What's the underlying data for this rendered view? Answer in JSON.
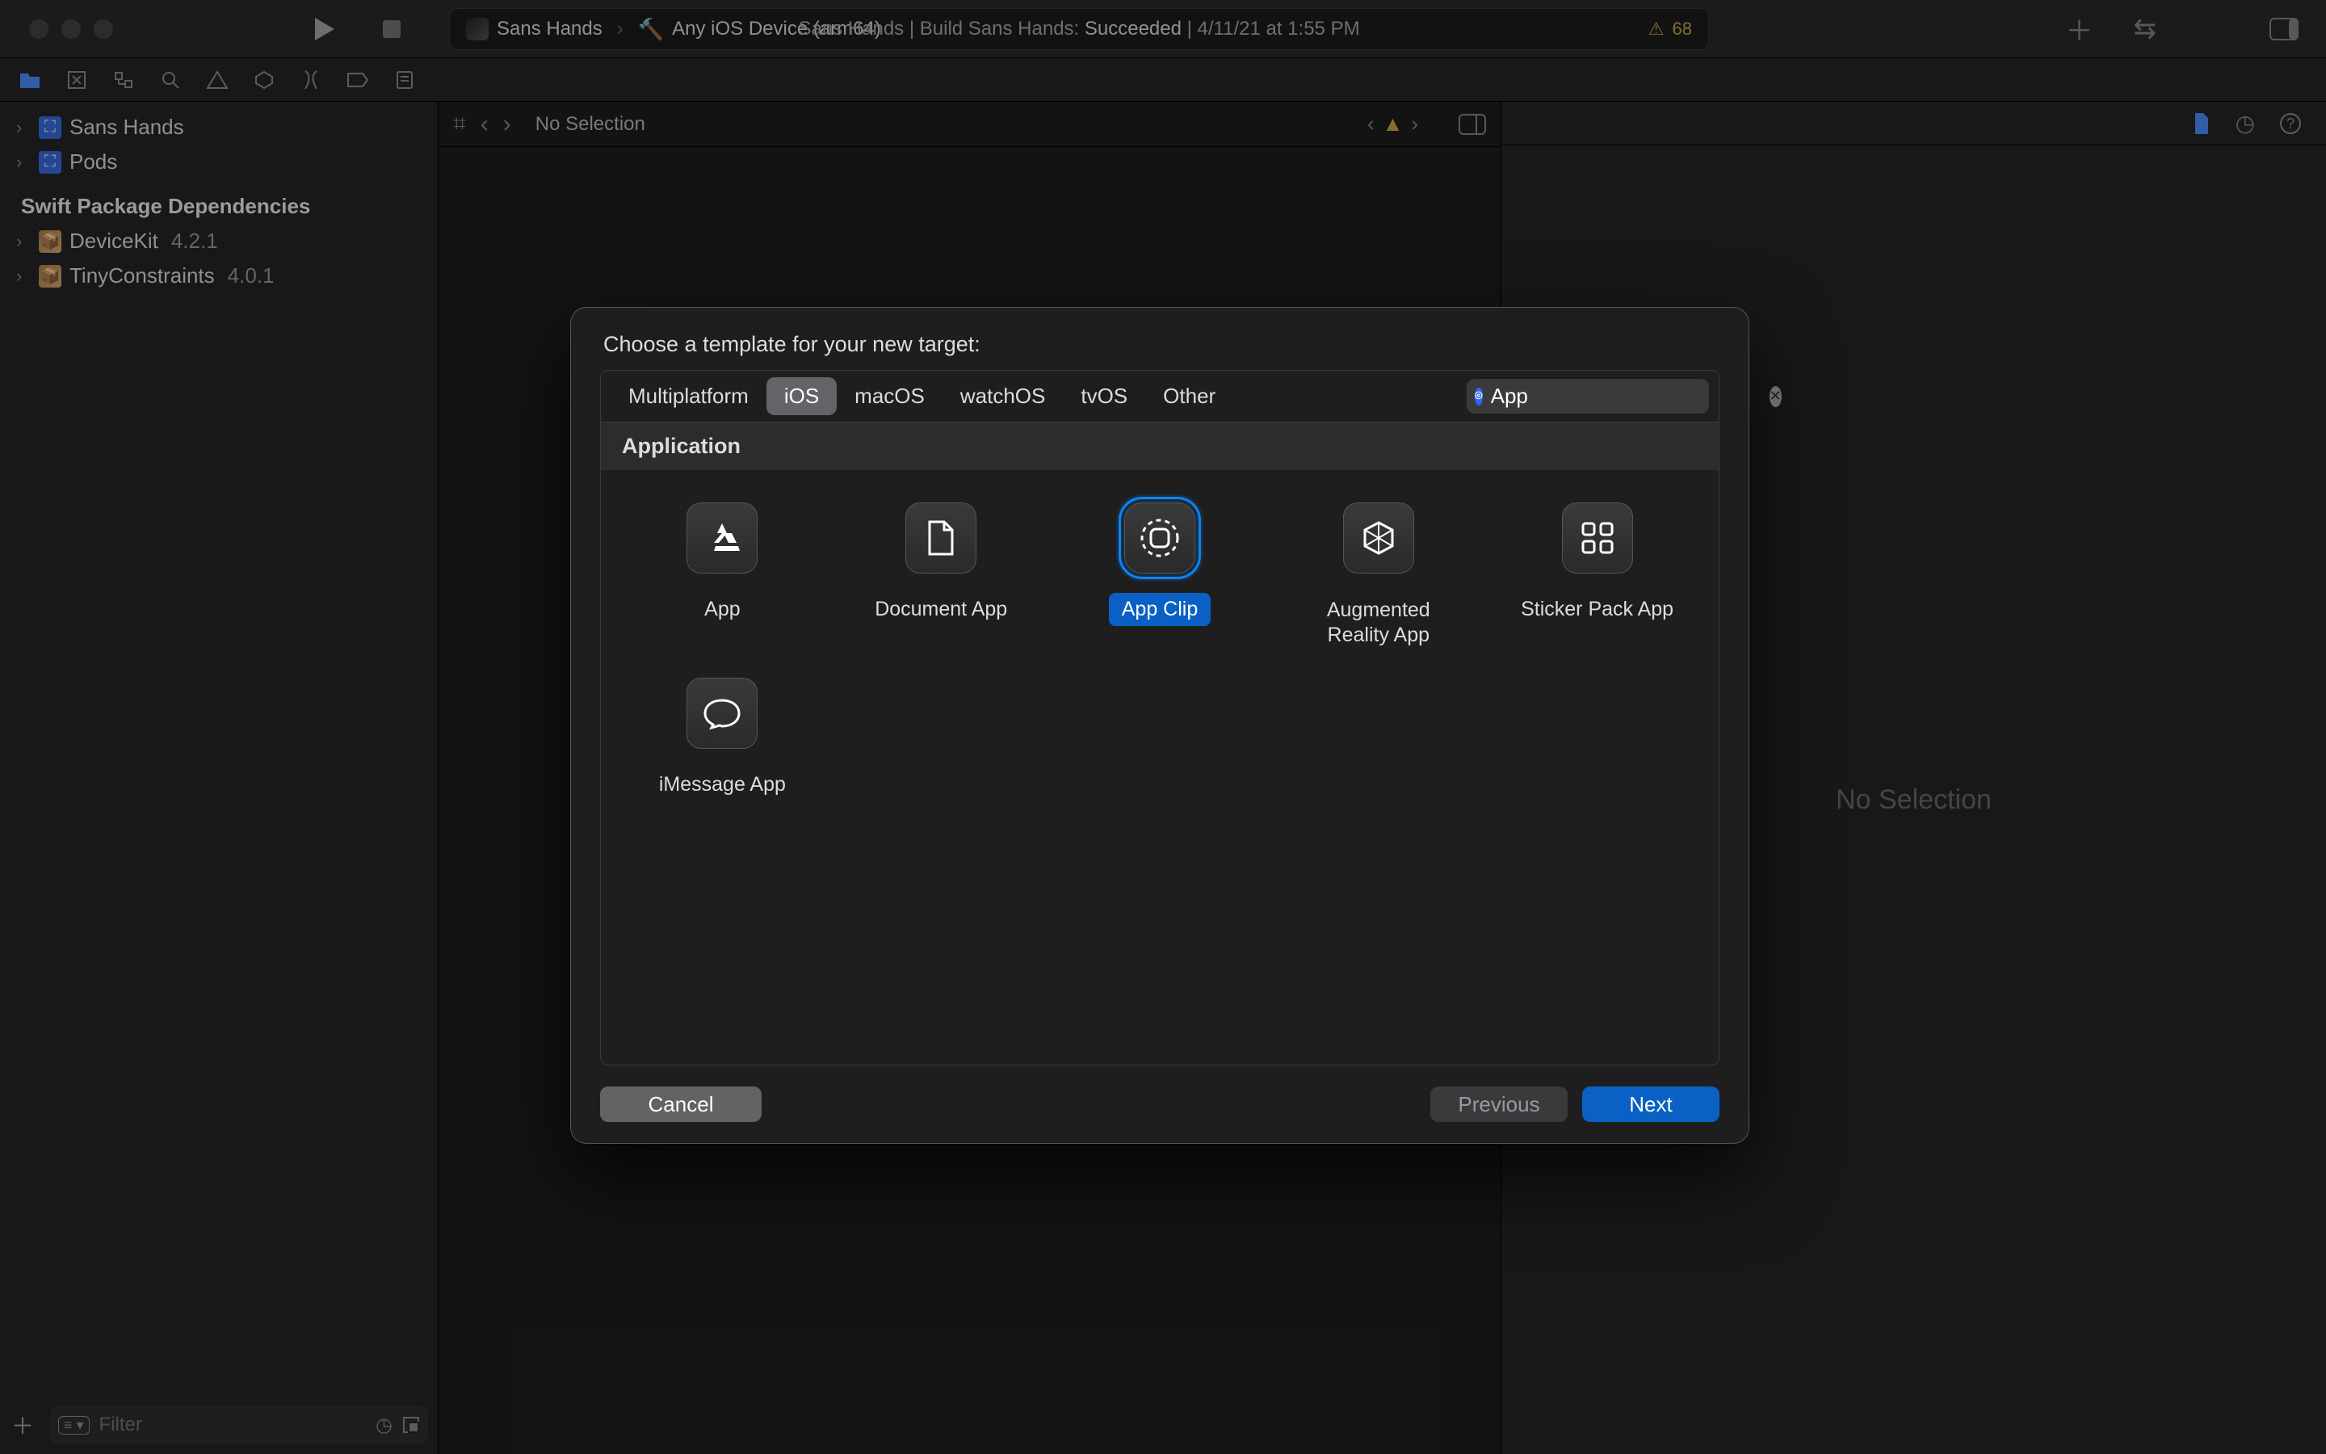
{
  "toolbar": {
    "scheme_project": "Sans Hands",
    "device": "Any iOS Device (arm64)",
    "status_prefix": "Sans Hands | Build Sans Hands: ",
    "status_word": "Succeeded",
    "status_suffix": " | 4/11/21 at 1:55 PM",
    "warning_count": "68"
  },
  "navigator": {
    "projects": [
      {
        "name": "Sans Hands"
      },
      {
        "name": "Pods"
      }
    ],
    "section": "Swift Package Dependencies",
    "packages": [
      {
        "name": "DeviceKit",
        "version": "4.2.1"
      },
      {
        "name": "TinyConstraints",
        "version": "4.0.1"
      }
    ],
    "filter_placeholder": "Filter"
  },
  "jump_bar": {
    "text": "No Selection"
  },
  "inspector": {
    "placeholder": "No Selection"
  },
  "modal": {
    "title": "Choose a template for your new target:",
    "platforms": [
      "Multiplatform",
      "iOS",
      "macOS",
      "watchOS",
      "tvOS",
      "Other"
    ],
    "active_platform": "iOS",
    "filter_text": "App",
    "group_name": "Application",
    "templates": [
      {
        "name": "App",
        "icon": "app-a"
      },
      {
        "name": "Document App",
        "icon": "doc"
      },
      {
        "name": "App Clip",
        "icon": "appclip",
        "selected": true
      },
      {
        "name": "Augmented Reality App",
        "icon": "ar",
        "twoLine": true
      },
      {
        "name": "Sticker Pack App",
        "icon": "grid"
      },
      {
        "name": "iMessage App",
        "icon": "bubble"
      }
    ],
    "buttons": {
      "cancel": "Cancel",
      "previous": "Previous",
      "next": "Next"
    }
  }
}
